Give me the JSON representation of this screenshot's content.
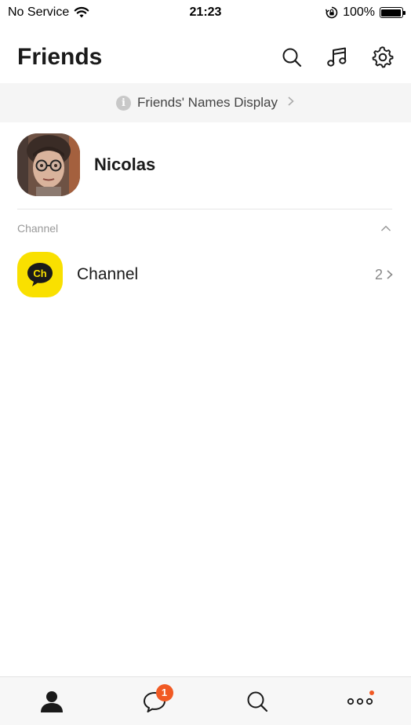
{
  "status_bar": {
    "carrier": "No Service",
    "time": "21:23",
    "battery": "100%"
  },
  "header": {
    "title": "Friends",
    "icons": [
      "search-icon",
      "music-icon",
      "settings-icon"
    ]
  },
  "banner": {
    "text": "Friends' Names Display",
    "icon": "info-icon"
  },
  "profile": {
    "name": "Nicolas"
  },
  "channel_section": {
    "header": "Channel",
    "item": {
      "logo_text": "Ch",
      "label": "Channel",
      "count": "2"
    }
  },
  "tab_bar": {
    "tabs": [
      {
        "icon": "person-icon"
      },
      {
        "icon": "chat-icon",
        "badge": "1"
      },
      {
        "icon": "search-icon"
      },
      {
        "icon": "more-icon"
      }
    ]
  },
  "colors": {
    "accent": "#f15a24",
    "channel_yellow": "#f9e000",
    "banner_bg": "#f5f5f5"
  }
}
